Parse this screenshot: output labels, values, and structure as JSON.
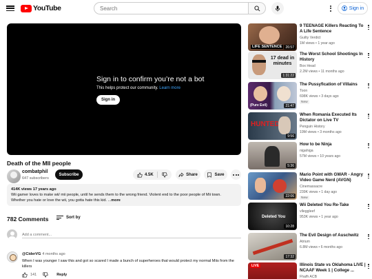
{
  "header": {
    "logo_text": "YouTube",
    "search_placeholder": "Search",
    "signin_label": "Sign in"
  },
  "player": {
    "title": "Sign in to confirm you’re not a bot",
    "subtitle": "This helps protect our community.",
    "learn_more": "Learn more",
    "signin_button": "Sign in"
  },
  "video": {
    "title": "Death of the MII people",
    "channel": "combatphil",
    "subscribers": "647 subscribers",
    "subscribe_label": "Subscribe",
    "likes": "4.5K",
    "share_label": "Share",
    "save_label": "Save"
  },
  "description": {
    "stats": "414K views  17 years ago",
    "line1": "Wii gamer loves to make wii/ mii people, until he sends them to the wrong friend. Violent end to the poor people of Mii town.",
    "line2": "Whether you hate or love the wii, you gotta hate this kid. ...",
    "more": "more"
  },
  "comments": {
    "count_label": "782 Comments",
    "sort_label": "Sort by",
    "add_placeholder": "Add a comment...",
    "items": [
      {
        "author": "@CiderVG",
        "time": "4 months ago",
        "text": "When I was younger I saw this and got so scared I made a bunch of superheroes that would protect my normal Miis from the killers",
        "likes": "141",
        "reply_label": "Reply"
      }
    ]
  },
  "recommendations": [
    {
      "title": "9 TEENAGE Killers Reacting To A Life Sentence",
      "channel": "Guilty Verdict",
      "meta": "1M views • 1 year ago",
      "duration": "26:57",
      "badge": "",
      "thumb_text": "LIFE SENTENCE"
    },
    {
      "title": "The Worst School Shootings In History",
      "channel": "Box Head",
      "meta": "2.2M views • 11 months ago",
      "duration": "1:31:22",
      "badge": "",
      "thumb_text": "17 dead in minutes"
    },
    {
      "title": "The Pussyfication of Villains",
      "channel": "Toon",
      "meta": "698K views • 3 days ago",
      "duration": "21:47",
      "badge": "New",
      "thumb_text": "(Pure Evil)"
    },
    {
      "title": "When Romania Executed Its Dictator on Live TV",
      "channel": "Penguin History",
      "meta": "19M views • 3 months ago",
      "duration": "9:56",
      "badge": "",
      "thumb_text": "HUNTED"
    },
    {
      "title": "How to be Ninja",
      "channel": "nigahiga",
      "meta": "57M views • 10 years ago",
      "duration": "5:36",
      "badge": "",
      "thumb_text": ""
    },
    {
      "title": "Mario Point with GWAR - Angry Video Game Nerd (AVGN)",
      "channel": "Cinemassacre",
      "meta": "239K views • 1 day ago",
      "duration": "22:06",
      "badge": "New",
      "thumb_text": ""
    },
    {
      "title": "Wii Deleted You Re-Take",
      "channel": "vlleggleef",
      "meta": "953K views • 1 year ago",
      "duration": "10:28",
      "badge": "",
      "thumb_text": "Deleted You"
    },
    {
      "title": "The Evil Design of Auschwitz",
      "channel": "Atrium",
      "meta": "6.8M views • 6 months ago",
      "duration": "17:32",
      "badge": "",
      "thumb_text": ""
    },
    {
      "title": "Illinois State vs Oklahoma LIVE | NCAAF Week 1 | College ...",
      "channel": "Fhafh ACB",
      "meta": "",
      "duration": "",
      "badge": "",
      "thumb_text": "LIVE"
    }
  ],
  "colors": {
    "brand_red": "#ff0000",
    "link_blue": "#065fd4",
    "text_primary": "#0f0f0f",
    "text_secondary": "#606060",
    "chip_bg": "#f2f2f2"
  }
}
